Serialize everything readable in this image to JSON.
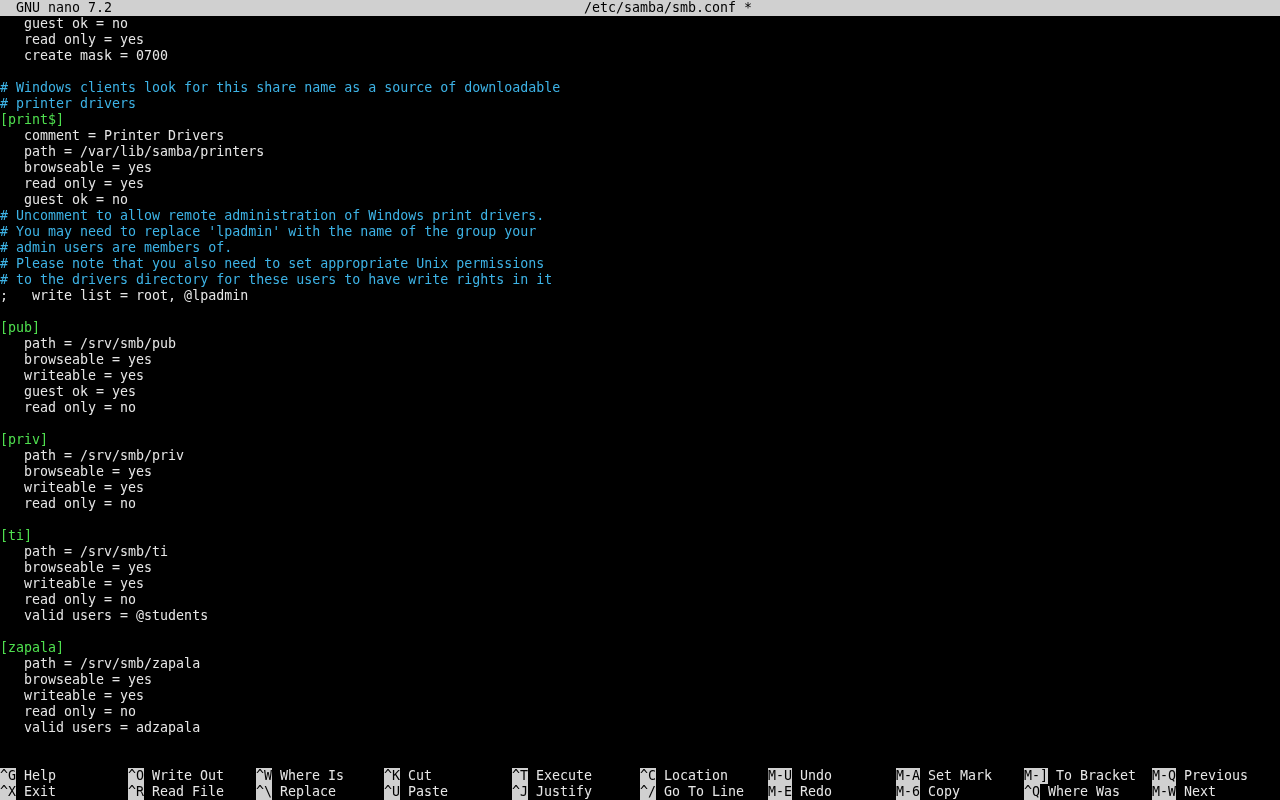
{
  "title_bar": {
    "app": "GNU nano 7.2",
    "file": "/etc/samba/smb.conf *"
  },
  "lines": [
    {
      "kind": "text",
      "text": "   guest ok = no"
    },
    {
      "kind": "text",
      "text": "   read only = yes"
    },
    {
      "kind": "text",
      "text": "   create mask = 0700"
    },
    {
      "kind": "blank"
    },
    {
      "kind": "comment",
      "text": "# Windows clients look for this share name as a source of downloadable"
    },
    {
      "kind": "comment",
      "text": "# printer drivers"
    },
    {
      "kind": "section",
      "text": "[print$]"
    },
    {
      "kind": "text",
      "text": "   comment = Printer Drivers"
    },
    {
      "kind": "text",
      "text": "   path = /var/lib/samba/printers"
    },
    {
      "kind": "text",
      "text": "   browseable = yes"
    },
    {
      "kind": "text",
      "text": "   read only = yes"
    },
    {
      "kind": "text",
      "text": "   guest ok = no"
    },
    {
      "kind": "comment",
      "text": "# Uncomment to allow remote administration of Windows print drivers."
    },
    {
      "kind": "comment",
      "text": "# You may need to replace 'lpadmin' with the name of the group your"
    },
    {
      "kind": "comment",
      "text": "# admin users are members of."
    },
    {
      "kind": "comment",
      "text": "# Please note that you also need to set appropriate Unix permissions"
    },
    {
      "kind": "comment",
      "text": "# to the drivers directory for these users to have write rights in it"
    },
    {
      "kind": "text",
      "text": ";   write list = root, @lpadmin"
    },
    {
      "kind": "blank"
    },
    {
      "kind": "section",
      "text": "[pub]"
    },
    {
      "kind": "text",
      "text": "   path = /srv/smb/pub"
    },
    {
      "kind": "text",
      "text": "   browseable = yes"
    },
    {
      "kind": "text",
      "text": "   writeable = yes"
    },
    {
      "kind": "text",
      "text": "   guest ok = yes"
    },
    {
      "kind": "text",
      "text": "   read only = no"
    },
    {
      "kind": "blank"
    },
    {
      "kind": "section",
      "text": "[priv]"
    },
    {
      "kind": "text",
      "text": "   path = /srv/smb/priv"
    },
    {
      "kind": "text",
      "text": "   browseable = yes"
    },
    {
      "kind": "text",
      "text": "   writeable = yes"
    },
    {
      "kind": "text",
      "text": "   read only = no"
    },
    {
      "kind": "blank"
    },
    {
      "kind": "section",
      "text": "[ti]"
    },
    {
      "kind": "text",
      "text": "   path = /srv/smb/ti"
    },
    {
      "kind": "text",
      "text": "   browseable = yes"
    },
    {
      "kind": "text",
      "text": "   writeable = yes"
    },
    {
      "kind": "text",
      "text": "   read only = no"
    },
    {
      "kind": "text",
      "text": "   valid users = @students"
    },
    {
      "kind": "blank"
    },
    {
      "kind": "section",
      "text": "[zapala]"
    },
    {
      "kind": "text",
      "text": "   path = /srv/smb/zapala"
    },
    {
      "kind": "text",
      "text": "   browseable = yes"
    },
    {
      "kind": "text",
      "text": "   writeable = yes"
    },
    {
      "kind": "text",
      "text": "   read only = no"
    },
    {
      "kind": "text",
      "text": "   valid users = adzapala"
    }
  ],
  "shortcut_rows": [
    [
      {
        "key": "^G",
        "label": "Help"
      },
      {
        "key": "^O",
        "label": "Write Out"
      },
      {
        "key": "^W",
        "label": "Where Is"
      },
      {
        "key": "^K",
        "label": "Cut"
      },
      {
        "key": "^T",
        "label": "Execute"
      },
      {
        "key": "^C",
        "label": "Location"
      },
      {
        "key": "M-U",
        "label": "Undo"
      },
      {
        "key": "M-A",
        "label": "Set Mark"
      },
      {
        "key": "M-]",
        "label": "To Bracket"
      },
      {
        "key": "M-Q",
        "label": "Previous"
      }
    ],
    [
      {
        "key": "^X",
        "label": "Exit"
      },
      {
        "key": "^R",
        "label": "Read File"
      },
      {
        "key": "^\\",
        "label": "Replace"
      },
      {
        "key": "^U",
        "label": "Paste"
      },
      {
        "key": "^J",
        "label": "Justify"
      },
      {
        "key": "^/",
        "label": "Go To Line"
      },
      {
        "key": "M-E",
        "label": "Redo"
      },
      {
        "key": "M-6",
        "label": "Copy"
      },
      {
        "key": "^Q",
        "label": "Where Was"
      },
      {
        "key": "M-W",
        "label": "Next"
      }
    ]
  ]
}
